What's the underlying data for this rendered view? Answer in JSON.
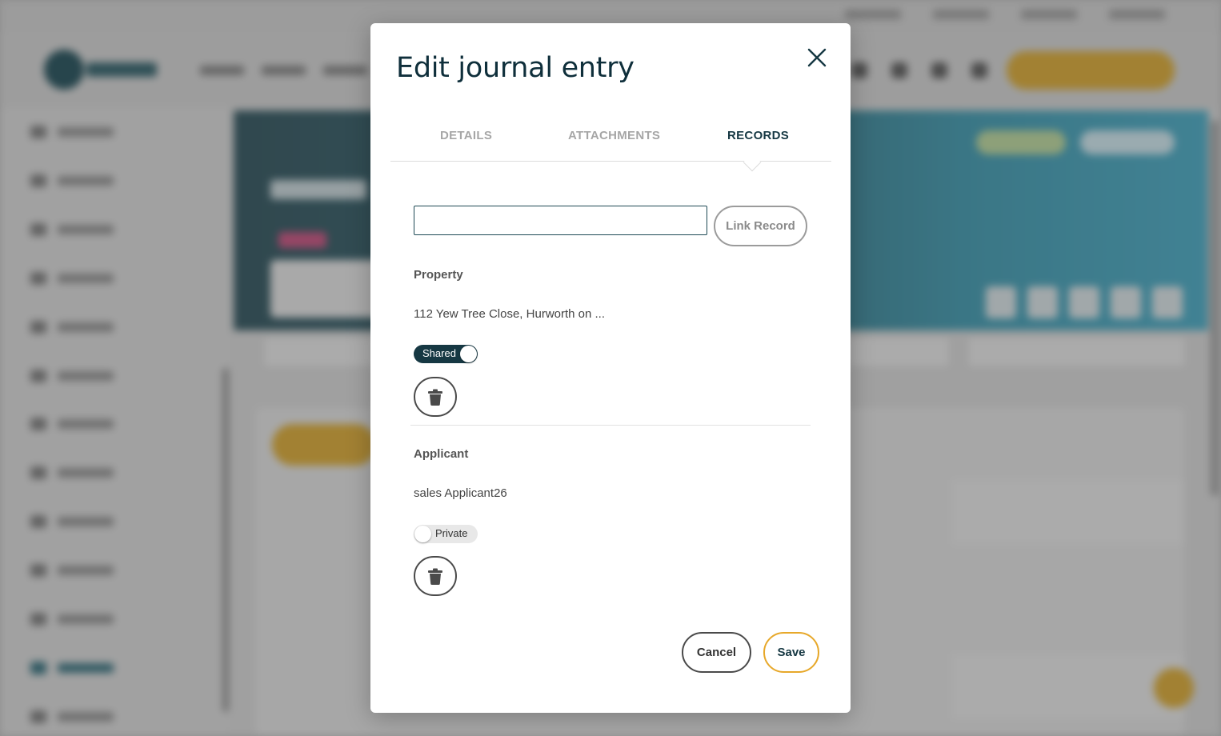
{
  "colors": {
    "primary": "#163843",
    "accent": "#e7a82a",
    "muted_tab": "#a6a6a6"
  },
  "modal": {
    "title": "Edit journal entry",
    "close_icon": "close-icon",
    "tabs": [
      {
        "label": "DETAILS",
        "active": false
      },
      {
        "label": "ATTACHMENTS",
        "active": false
      },
      {
        "label": "RECORDS",
        "active": true
      }
    ],
    "search": {
      "value": "",
      "placeholder": ""
    },
    "link_button_label": "Link Record",
    "records": [
      {
        "type_label": "Property",
        "value": "112 Yew Tree Close, Hurworth on ...",
        "toggle_label": "Shared",
        "toggle_on": true,
        "delete_icon": "trash-icon"
      },
      {
        "type_label": "Applicant",
        "value": "sales Applicant26",
        "toggle_label": "Private",
        "toggle_on": false,
        "delete_icon": "trash-icon"
      }
    ],
    "cancel_label": "Cancel",
    "save_label": "Save"
  }
}
